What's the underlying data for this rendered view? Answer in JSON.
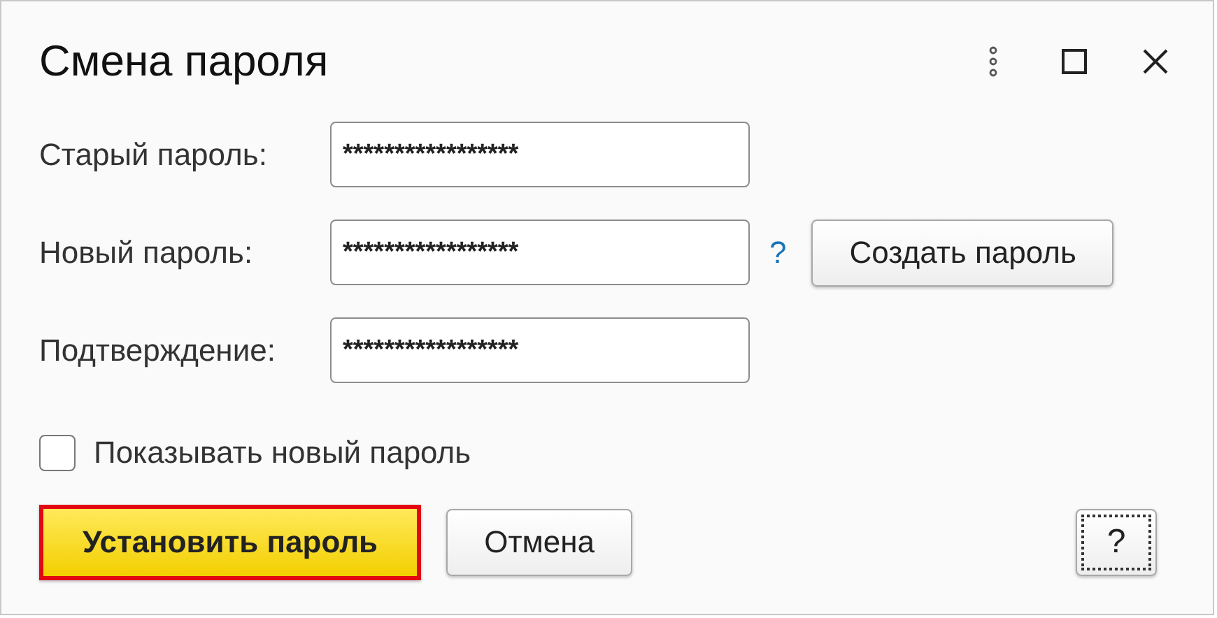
{
  "window": {
    "title": "Смена пароля"
  },
  "fields": [
    {
      "label": "Старый пароль:",
      "value": "*****************"
    },
    {
      "label": "Новый пароль:",
      "value": "*****************",
      "help_text": "?",
      "action": "Создать пароль"
    },
    {
      "label": "Подтверждение:",
      "value": "*****************"
    }
  ],
  "checkbox": {
    "label": "Показывать новый пароль",
    "checked": false
  },
  "buttons": [
    {
      "label": "Установить пароль",
      "kind": "default",
      "highlighted": true
    },
    {
      "label": "Отмена",
      "kind": "normal",
      "highlighted": false
    }
  ],
  "help_button": {
    "label": "?"
  }
}
